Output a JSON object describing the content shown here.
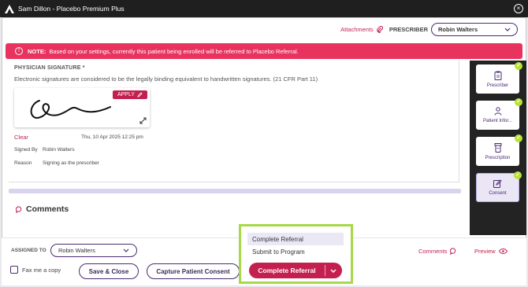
{
  "window": {
    "title": "Sam Dillon - Placebo Premium Plus",
    "close_glyph": "×"
  },
  "header": {
    "attachments_label": "Attachments",
    "prescriber_label": "PRESCRIBER",
    "prescriber_value": "Robin  Walters"
  },
  "notice": {
    "prefix": "NOTE:",
    "text": "Based on your settings, currently this patient being enrolled will be referred to Placebo Referral."
  },
  "signature": {
    "heading": "PHYSICIAN SIGNATURE *",
    "description": "Electronic signatures are considered to be the legally binding equivalent to handwritten signatures. (21 CFR Part 11)",
    "apply_label": "APPLY",
    "clear_label": "Clear",
    "date": "Thu, 10 Apr 2025 12:25 pm",
    "signed_by_label": "Signed By",
    "signed_by_value": "Robin Walters",
    "reason_label": "Reason",
    "reason_value": "Signing as the prescriber"
  },
  "sidebar": {
    "items": [
      {
        "label": "Prescriber",
        "icon": "clipboard-icon",
        "completed": true
      },
      {
        "label": "Patient Infor...",
        "icon": "person-icon",
        "completed": true
      },
      {
        "label": "Prescription",
        "icon": "pill-bottle-icon",
        "completed": true
      },
      {
        "label": "Consent",
        "icon": "edit-icon",
        "completed": true,
        "active": true
      }
    ]
  },
  "comments": {
    "title": "Comments"
  },
  "footer": {
    "assigned_label": "ASSIGNED TO",
    "assigned_value": "Robin  Walters",
    "fax_label": "Fax me a copy",
    "save_close_label": "Save & Close",
    "capture_consent_label": "Capture Patient Consent",
    "complete_label": "Complete Referral",
    "comments_link": "Comments",
    "preview_link": "Preview"
  },
  "dropdown_menu": {
    "options": [
      "Complete Referral",
      "Submit to Program"
    ],
    "highlighted": "Complete Referral"
  },
  "colors": {
    "accent": "#c4204f",
    "notice_bg": "#e8335f",
    "brand_purple": "#4a2a72",
    "check_green": "#b8e236",
    "highlight_outline": "#a7d848"
  }
}
